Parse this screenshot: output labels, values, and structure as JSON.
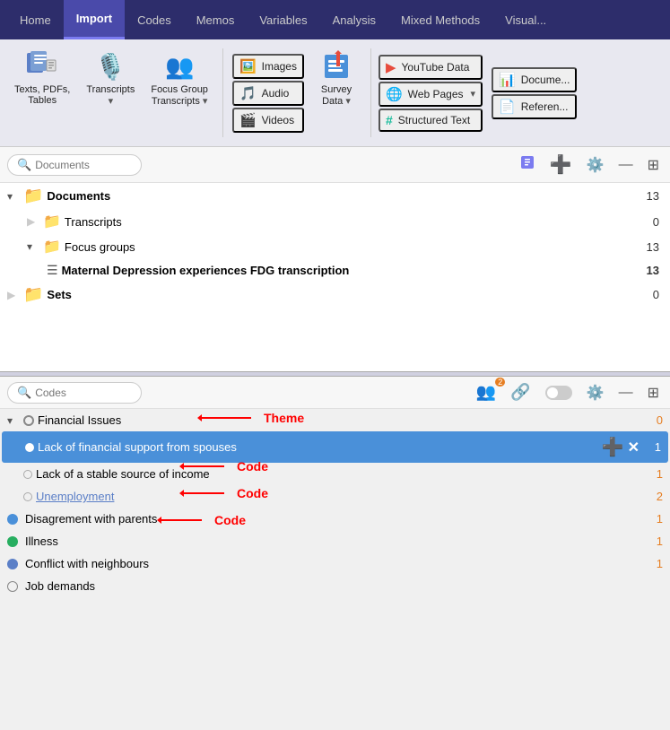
{
  "nav": {
    "items": [
      {
        "label": "Home",
        "active": false
      },
      {
        "label": "Import",
        "active": true
      },
      {
        "label": "Codes",
        "active": false
      },
      {
        "label": "Memos",
        "active": false
      },
      {
        "label": "Variables",
        "active": false
      },
      {
        "label": "Analysis",
        "active": false
      },
      {
        "label": "Mixed Methods",
        "active": false
      },
      {
        "label": "Visual...",
        "active": false
      }
    ]
  },
  "ribbon": {
    "groups": [
      {
        "id": "texts",
        "icon": "📄",
        "label": "Texts, PDFs,\nTables",
        "has_dropdown": false
      },
      {
        "id": "transcripts",
        "icon": "🎙️",
        "label": "Transcripts",
        "has_dropdown": true
      },
      {
        "id": "focus_group",
        "icon": "👥",
        "label": "Focus Group\nTranscripts",
        "has_dropdown": true
      }
    ],
    "small_buttons": [
      {
        "icon": "🖼️",
        "label": "Images",
        "color": "purple"
      },
      {
        "icon": "🎵",
        "label": "Audio",
        "color": "orange"
      },
      {
        "icon": "🎬",
        "label": "Videos",
        "color": "blue"
      }
    ],
    "survey": {
      "icon": "📊",
      "label": "Survey\nData",
      "has_dropdown": true
    },
    "right_buttons": [
      {
        "icon": "▶",
        "label": "YouTube Data",
        "color": "red"
      },
      {
        "icon": "🌐",
        "label": "Web Pages",
        "color": "teal",
        "has_dropdown": true
      },
      {
        "icon": "#",
        "label": "Structured Text",
        "color": "teal"
      },
      {
        "icon": "📊",
        "label": "Documents",
        "color": "excel"
      },
      {
        "icon": "📄",
        "label": "Reference...",
        "color": "yellow"
      }
    ]
  },
  "documents_panel": {
    "search_placeholder": "Documents",
    "toolbar_icons": [
      "purple-doc",
      "add-green",
      "settings",
      "minus",
      "expand"
    ],
    "tree": {
      "items": [
        {
          "id": "documents",
          "label": "Documents",
          "indent": 0,
          "type": "folder",
          "color": "blue",
          "expanded": true,
          "count": "13",
          "arrow": "▾"
        },
        {
          "id": "transcripts",
          "label": "Transcripts",
          "indent": 1,
          "type": "folder",
          "color": "blue",
          "expanded": false,
          "count": "0",
          "arrow": ""
        },
        {
          "id": "focus_groups",
          "label": "Focus groups",
          "indent": 1,
          "type": "folder",
          "color": "blue",
          "expanded": true,
          "count": "13",
          "arrow": "▾"
        },
        {
          "id": "maternal",
          "label": "Maternal Depression experiences FDG transcription",
          "indent": 2,
          "type": "doc",
          "color": "",
          "expanded": false,
          "count": "13",
          "arrow": "",
          "bold": true
        },
        {
          "id": "sets",
          "label": "Sets",
          "indent": 0,
          "type": "folder",
          "color": "yellow",
          "expanded": false,
          "count": "0",
          "arrow": ""
        }
      ]
    }
  },
  "codes_panel": {
    "search_placeholder": "Codes",
    "badge_count": "2",
    "toolbar_icons": [
      "group-code",
      "code-link",
      "toggle",
      "settings",
      "minus",
      "expand"
    ],
    "codes": [
      {
        "id": "financial_issues",
        "label": "Financial Issues",
        "indent": 0,
        "dot_color": "#888",
        "dot_outline": true,
        "count": "0",
        "expanded": true,
        "arrow": "▾",
        "is_theme": true
      },
      {
        "id": "lack_financial_support",
        "label": "Lack of financial support from spouses",
        "indent": 1,
        "dot_color": "#5b7fc7",
        "dot_outline": false,
        "count": "1",
        "selected": true,
        "has_actions": true
      },
      {
        "id": "lack_stable_source",
        "label": "Lack of a stable source of income",
        "indent": 1,
        "dot_color": "#aaa",
        "dot_outline": false,
        "count": "1"
      },
      {
        "id": "unemployment",
        "label": "Unemployment",
        "indent": 1,
        "dot_color": "#aaa",
        "dot_outline": false,
        "count": "2",
        "is_link": true
      },
      {
        "id": "disagreement_parents",
        "label": "Disagrement with parents",
        "indent": 0,
        "dot_color": "#4a90d9",
        "dot_outline": false,
        "count": "1"
      },
      {
        "id": "illness",
        "label": "Illness",
        "indent": 0,
        "dot_color": "#27ae60",
        "dot_outline": false,
        "count": "1"
      },
      {
        "id": "conflict_neighbours",
        "label": "Conflict with neighbours",
        "indent": 0,
        "dot_color": "#5b7fc7",
        "dot_outline": false,
        "count": "1"
      },
      {
        "id": "job_demands",
        "label": "Job demands",
        "indent": 0,
        "dot_color": "#888",
        "dot_outline": false,
        "count": ""
      }
    ]
  },
  "annotations": {
    "theme_label": "Theme",
    "code_label1": "Code",
    "code_label2": "Code",
    "code_label3": "Code"
  }
}
